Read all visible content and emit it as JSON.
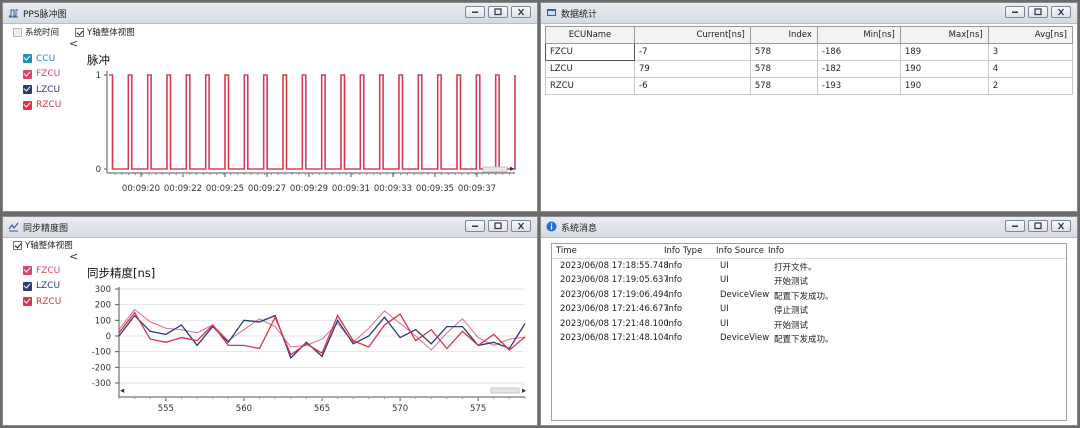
{
  "colors": {
    "ccu": "#1f8fb6",
    "fzcu": "#d7456b",
    "lzcu": "#2b3b75",
    "rzcu": "#d8344a",
    "info_icon": "#1e6fd0"
  },
  "pps": {
    "title": "PPS脉冲图",
    "opt_system_time": "系统时间",
    "opt_y_overall": "Y轴整体视图",
    "legend": [
      "CCU",
      "FZCU",
      "LZCU",
      "RZCU"
    ],
    "chart_title": "脉冲",
    "yticks": [
      "1",
      "0"
    ],
    "xticks": [
      "00:09:20",
      "00:09:22",
      "00:09:25",
      "00:09:27",
      "00:09:29",
      "00:09:31",
      "00:09:33",
      "00:09:35",
      "00:09:37"
    ]
  },
  "stats": {
    "title": "数据统计",
    "columns": [
      "ECUName",
      "Current[ns]",
      "Index",
      "Min[ns]",
      "Max[ns]",
      "Avg[ns]"
    ],
    "rows": [
      [
        "FZCU",
        "-7",
        "578",
        "-186",
        "189",
        "3"
      ],
      [
        "LZCU",
        "79",
        "578",
        "-182",
        "190",
        "4"
      ],
      [
        "RZCU",
        "-6",
        "578",
        "-193",
        "190",
        "2"
      ]
    ]
  },
  "sync": {
    "title": "同步精度图",
    "opt_y_overall": "Y轴整体视图",
    "legend": [
      "FZCU",
      "LZCU",
      "RZCU"
    ],
    "chart_title": "同步精度[ns]"
  },
  "messages": {
    "title": "系统消息",
    "columns": [
      "Time",
      "Info Type",
      "Info Source",
      "Info"
    ],
    "rows": [
      [
        "2023/06/08 17:18:55.748",
        "Info",
        "UI",
        "打开文件。"
      ],
      [
        "2023/06/08 17:19:05.637",
        "Info",
        "UI",
        "开始测试"
      ],
      [
        "2023/06/08 17:19:06.494",
        "Info",
        "DeviceView",
        "配置下发成功。"
      ],
      [
        "2023/06/08 17:21:46.677",
        "Info",
        "UI",
        "停止测试"
      ],
      [
        "2023/06/08 17:21:48.100",
        "Info",
        "UI",
        "开始测试"
      ],
      [
        "2023/06/08 17:21:48.104",
        "Info",
        "DeviceView",
        "配置下发成功。"
      ]
    ]
  },
  "chart_data": [
    {
      "type": "line",
      "title": "脉冲",
      "x_tick_labels": [
        "00:09:20",
        "00:09:22",
        "00:09:25",
        "00:09:27",
        "00:09:29",
        "00:09:31",
        "00:09:33",
        "00:09:35",
        "00:09:37"
      ],
      "ylim": [
        0,
        1
      ],
      "series": [
        {
          "name": "FZCU",
          "pattern": "square",
          "high": 1,
          "low": 0,
          "pulses": 21
        },
        {
          "name": "RZCU",
          "pattern": "square",
          "high": 1,
          "low": 0,
          "pulses": 21
        }
      ]
    },
    {
      "type": "line",
      "title": "同步精度[ns]",
      "x": [
        552,
        553,
        554,
        555,
        556,
        557,
        558,
        559,
        560,
        561,
        562,
        563,
        564,
        565,
        566,
        567,
        568,
        569,
        570,
        571,
        572,
        573,
        574,
        575,
        576,
        577,
        578
      ],
      "xlim": [
        552,
        578
      ],
      "x_ticks": [
        555,
        560,
        565,
        570,
        575
      ],
      "ylim": [
        -300,
        300
      ],
      "y_ticks": [
        300,
        200,
        100,
        0,
        -100,
        -200,
        -300
      ],
      "series": [
        {
          "name": "FZCU",
          "values": [
            40,
            170,
            90,
            50,
            40,
            20,
            70,
            -30,
            40,
            110,
            60,
            -70,
            -60,
            -20,
            80,
            -40,
            50,
            160,
            80,
            0,
            -90,
            20,
            110,
            -10,
            -60,
            -20,
            -7
          ]
        },
        {
          "name": "LZCU",
          "values": [
            0,
            130,
            30,
            10,
            70,
            -60,
            60,
            -40,
            100,
            90,
            130,
            -140,
            -40,
            -130,
            100,
            -50,
            0,
            120,
            -10,
            40,
            -50,
            60,
            60,
            -60,
            -40,
            -80,
            79
          ]
        },
        {
          "name": "RZCU",
          "values": [
            20,
            150,
            -20,
            -40,
            -10,
            -30,
            70,
            -60,
            -60,
            -80,
            120,
            -120,
            -50,
            -110,
            130,
            -30,
            -70,
            70,
            140,
            -30,
            40,
            -80,
            30,
            -60,
            10,
            -90,
            -6
          ]
        }
      ]
    }
  ]
}
